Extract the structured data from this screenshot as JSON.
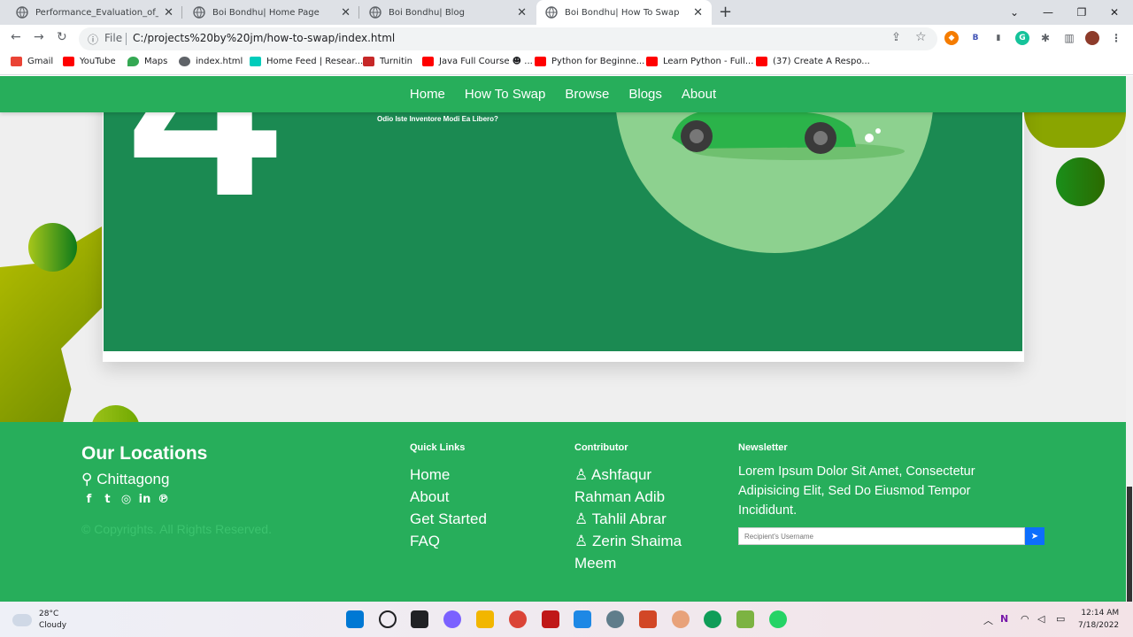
{
  "tabs": [
    {
      "title": "Performance_Evaluation_of_Vario",
      "active": false
    },
    {
      "title": "Boi Bondhu| Home Page",
      "active": false
    },
    {
      "title": "Boi Bondhu| Blog",
      "active": false
    },
    {
      "title": "Boi Bondhu| How To Swap",
      "active": true
    }
  ],
  "toolbar": {
    "file_label": "File",
    "url": "C:/projects%20by%20jm/how-to-swap/index.html"
  },
  "bookmarks": [
    {
      "label": "Gmail",
      "color": "#ea4335"
    },
    {
      "label": "YouTube",
      "color": "#ff0000"
    },
    {
      "label": "Maps",
      "color": "#34a853"
    },
    {
      "label": "index.html",
      "color": "#5f6368"
    },
    {
      "label": "Home Feed | Resear...",
      "color": "#00ccbb"
    },
    {
      "label": "Turnitin",
      "color": "#c62828"
    },
    {
      "label": "Java Full Course ☻ ...",
      "color": "#ff0000"
    },
    {
      "label": "Python for Beginne...",
      "color": "#ff0000"
    },
    {
      "label": "Learn Python - Full...",
      "color": "#ff0000"
    },
    {
      "label": "(37) Create A Respo...",
      "color": "#ff0000"
    }
  ],
  "nav": {
    "items": [
      "Home",
      "How To Swap",
      "Browse",
      "Blogs",
      "About"
    ]
  },
  "hero": {
    "step_number": "4",
    "tagline": "Odio Iste Inventore Modi Ea Libero?"
  },
  "footer": {
    "locations_title": "Our Locations",
    "city": "Chittagong",
    "copyright": "© Copyrights. All Rights Reserved.",
    "quick_links_title": "Quick Links",
    "quick_links": [
      "Home",
      "About",
      "Get Started",
      "FAQ"
    ],
    "contributor_title": "Contributor",
    "contributors": [
      "Ashfaqur Rahman Adib",
      "Tahlil Abrar",
      "Zerin Shaima Meem"
    ],
    "newsletter_title": "Newsletter",
    "newsletter_text": "Lorem Ipsum Dolor Sit Amet, Consectetur Adipisicing Elit, Sed Do Eiusmod Tempor Incididunt.",
    "newsletter_placeholder": "Recipient's Username"
  },
  "taskbar": {
    "temp": "28°C",
    "condition": "Cloudy",
    "time": "12:14 AM",
    "date": "7/18/2022"
  },
  "colors": {
    "brand_green": "#27ae5b",
    "card_green": "#1b8a52",
    "accent_blue": "#0d6efd"
  }
}
